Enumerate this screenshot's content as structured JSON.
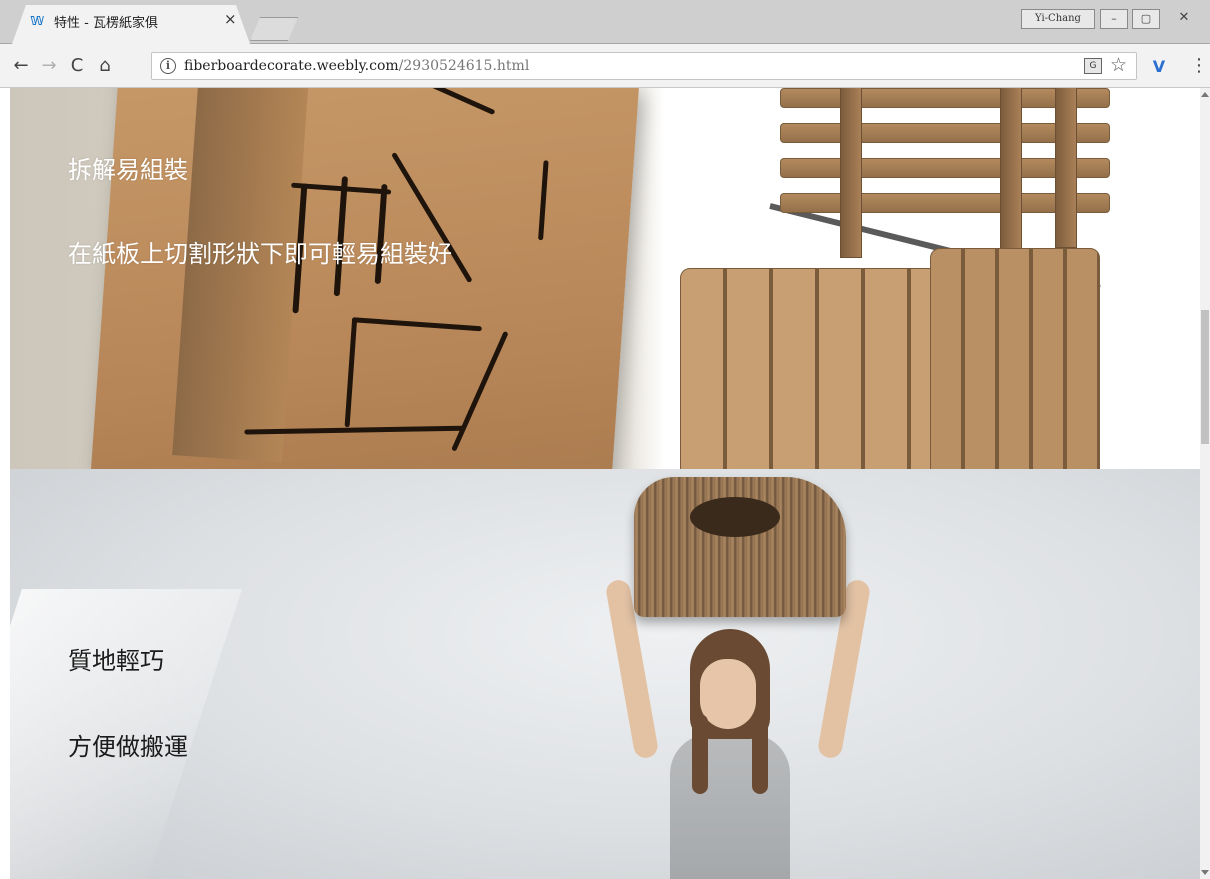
{
  "browser": {
    "tab": {
      "title": "特性 - 瓦楞紙家俱",
      "favicon_icon": "weebly-icon",
      "close_label": "×"
    },
    "profile_name": "Yi-Chang",
    "window_controls": {
      "minimize": "–",
      "maximize": "▢",
      "close": "✕"
    },
    "nav": {
      "back": "←",
      "forward": "→",
      "reload": "C",
      "home": "⌂"
    },
    "address": {
      "info_icon": "i",
      "host": "fiberboardecorate.weebly.com",
      "path": "/2930524615.html"
    },
    "extensions": {
      "translate": "G",
      "bookmark": "☆",
      "ext": "V",
      "menu": "⋮"
    }
  },
  "page": {
    "section1": {
      "heading": "拆解易組裝",
      "text": "在紙板上切割形狀下即可輕易組裝好"
    },
    "section2": {
      "heading": "質地輕巧",
      "text": "方便做搬運"
    }
  },
  "colors": {
    "tab_bg": "#f2f2f2",
    "tabstrip_bg": "#cfcfcf",
    "toolbar_bg": "#f2f2f2",
    "cardboard": "#b9885a"
  }
}
